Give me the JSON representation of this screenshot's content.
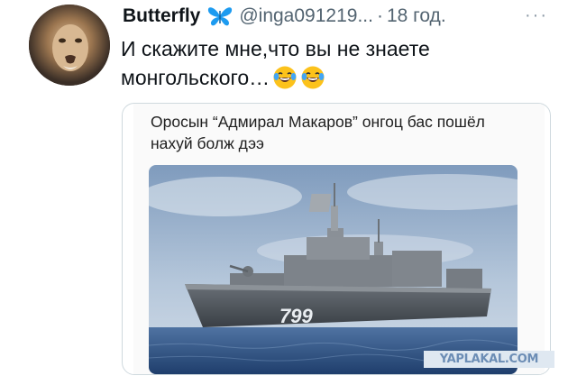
{
  "tweet": {
    "author_name": "Butterfly",
    "verified_icon": "butterfly-emoji",
    "handle": "@inga091219...",
    "separator": "·",
    "time": "18 год.",
    "more_icon": "more-dots-icon",
    "text": "И скажите мне,что вы не знаете монгольского…",
    "text_emojis": [
      "laughing-tears-emoji",
      "laughing-tears-emoji"
    ]
  },
  "quoted": {
    "caption": "Оросын “Адмирал Макаров” онгоц бас пошёл нахуй болж дээ",
    "hull_number": "799",
    "image": "warship-photo"
  },
  "watermark": {
    "text": "YAPLAKAL.COM"
  },
  "colors": {
    "text": "#0f1419",
    "secondary": "#536471",
    "border": "#cfd9de",
    "verified": "#1d9bf0"
  }
}
